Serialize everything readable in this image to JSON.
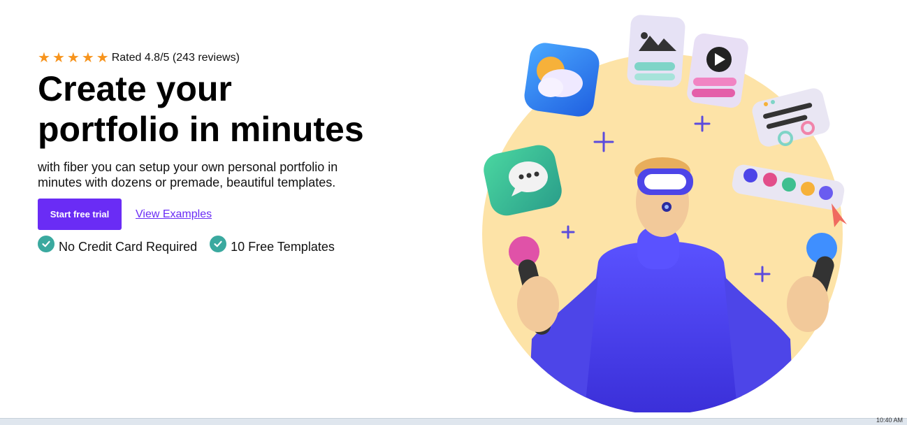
{
  "hero": {
    "rating": {
      "stars": 5,
      "text": "Rated 4.8/5 (243 reviews)"
    },
    "headline": {
      "line1": "Create your",
      "line2": "portfolio in minutes"
    },
    "subtext": "with fiber you can setup your own personal portfolio in minutes with dozens or premade, beautiful templates.",
    "cta": {
      "primary_label": "Start free trial",
      "secondary_label": "View Examples"
    },
    "features": [
      {
        "icon": "check-circle-icon",
        "label": "No Credit Card Required"
      },
      {
        "icon": "check-circle-icon",
        "label": "10 Free Templates"
      }
    ]
  },
  "colors": {
    "accent": "#6a2cf5",
    "star": "#f7941d",
    "check": "#3aa99f",
    "illustration_circle": "#fde3a7",
    "figure": "#4d45e8"
  },
  "taskbar": {
    "clock": "10:40 AM"
  }
}
